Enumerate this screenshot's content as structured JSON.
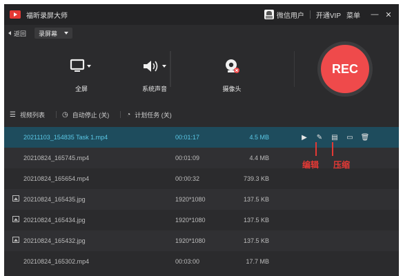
{
  "app": {
    "title": "福昕录屏大师"
  },
  "titlebar": {
    "user": "微信用户",
    "vip": "开通VIP",
    "menu": "菜单",
    "minimize": "—",
    "close": "✕"
  },
  "subbar": {
    "back": "返回",
    "mode": "录屏幕"
  },
  "controls": [
    {
      "label": "全屏",
      "icon": "monitor-icon"
    },
    {
      "label": "系统声音",
      "icon": "speaker-icon"
    },
    {
      "label": "摄像头",
      "icon": "webcam-icon"
    }
  ],
  "rec": {
    "label": "REC",
    "color": "#ef4a4b"
  },
  "options": {
    "list": "视频列表",
    "auto_stop": "自动停止 (关)",
    "schedule": "计划任务 (关)"
  },
  "files": [
    {
      "name": "20211103_154835 Task 1.mp4",
      "duration": "00:01:17",
      "size": "4.5 MB",
      "type": "video",
      "selected": true
    },
    {
      "name": "20210824_165745.mp4",
      "duration": "00:01:09",
      "size": "4.4 MB",
      "type": "video"
    },
    {
      "name": "20210824_165654.mp4",
      "duration": "00:00:32",
      "size": "739.3 KB",
      "type": "video"
    },
    {
      "name": "20210824_165435.jpg",
      "duration": "1920*1080",
      "size": "137.5 KB",
      "type": "image"
    },
    {
      "name": "20210824_165434.jpg",
      "duration": "1920*1080",
      "size": "137.5 KB",
      "type": "image"
    },
    {
      "name": "20210824_165432.jpg",
      "duration": "1920*1080",
      "size": "137.5 KB",
      "type": "image"
    },
    {
      "name": "20210824_165302.mp4",
      "duration": "00:03:00",
      "size": "17.7 MB",
      "type": "video"
    }
  ],
  "annotations": {
    "edit": "编辑",
    "compress": "压缩",
    "color": "#e53935"
  }
}
